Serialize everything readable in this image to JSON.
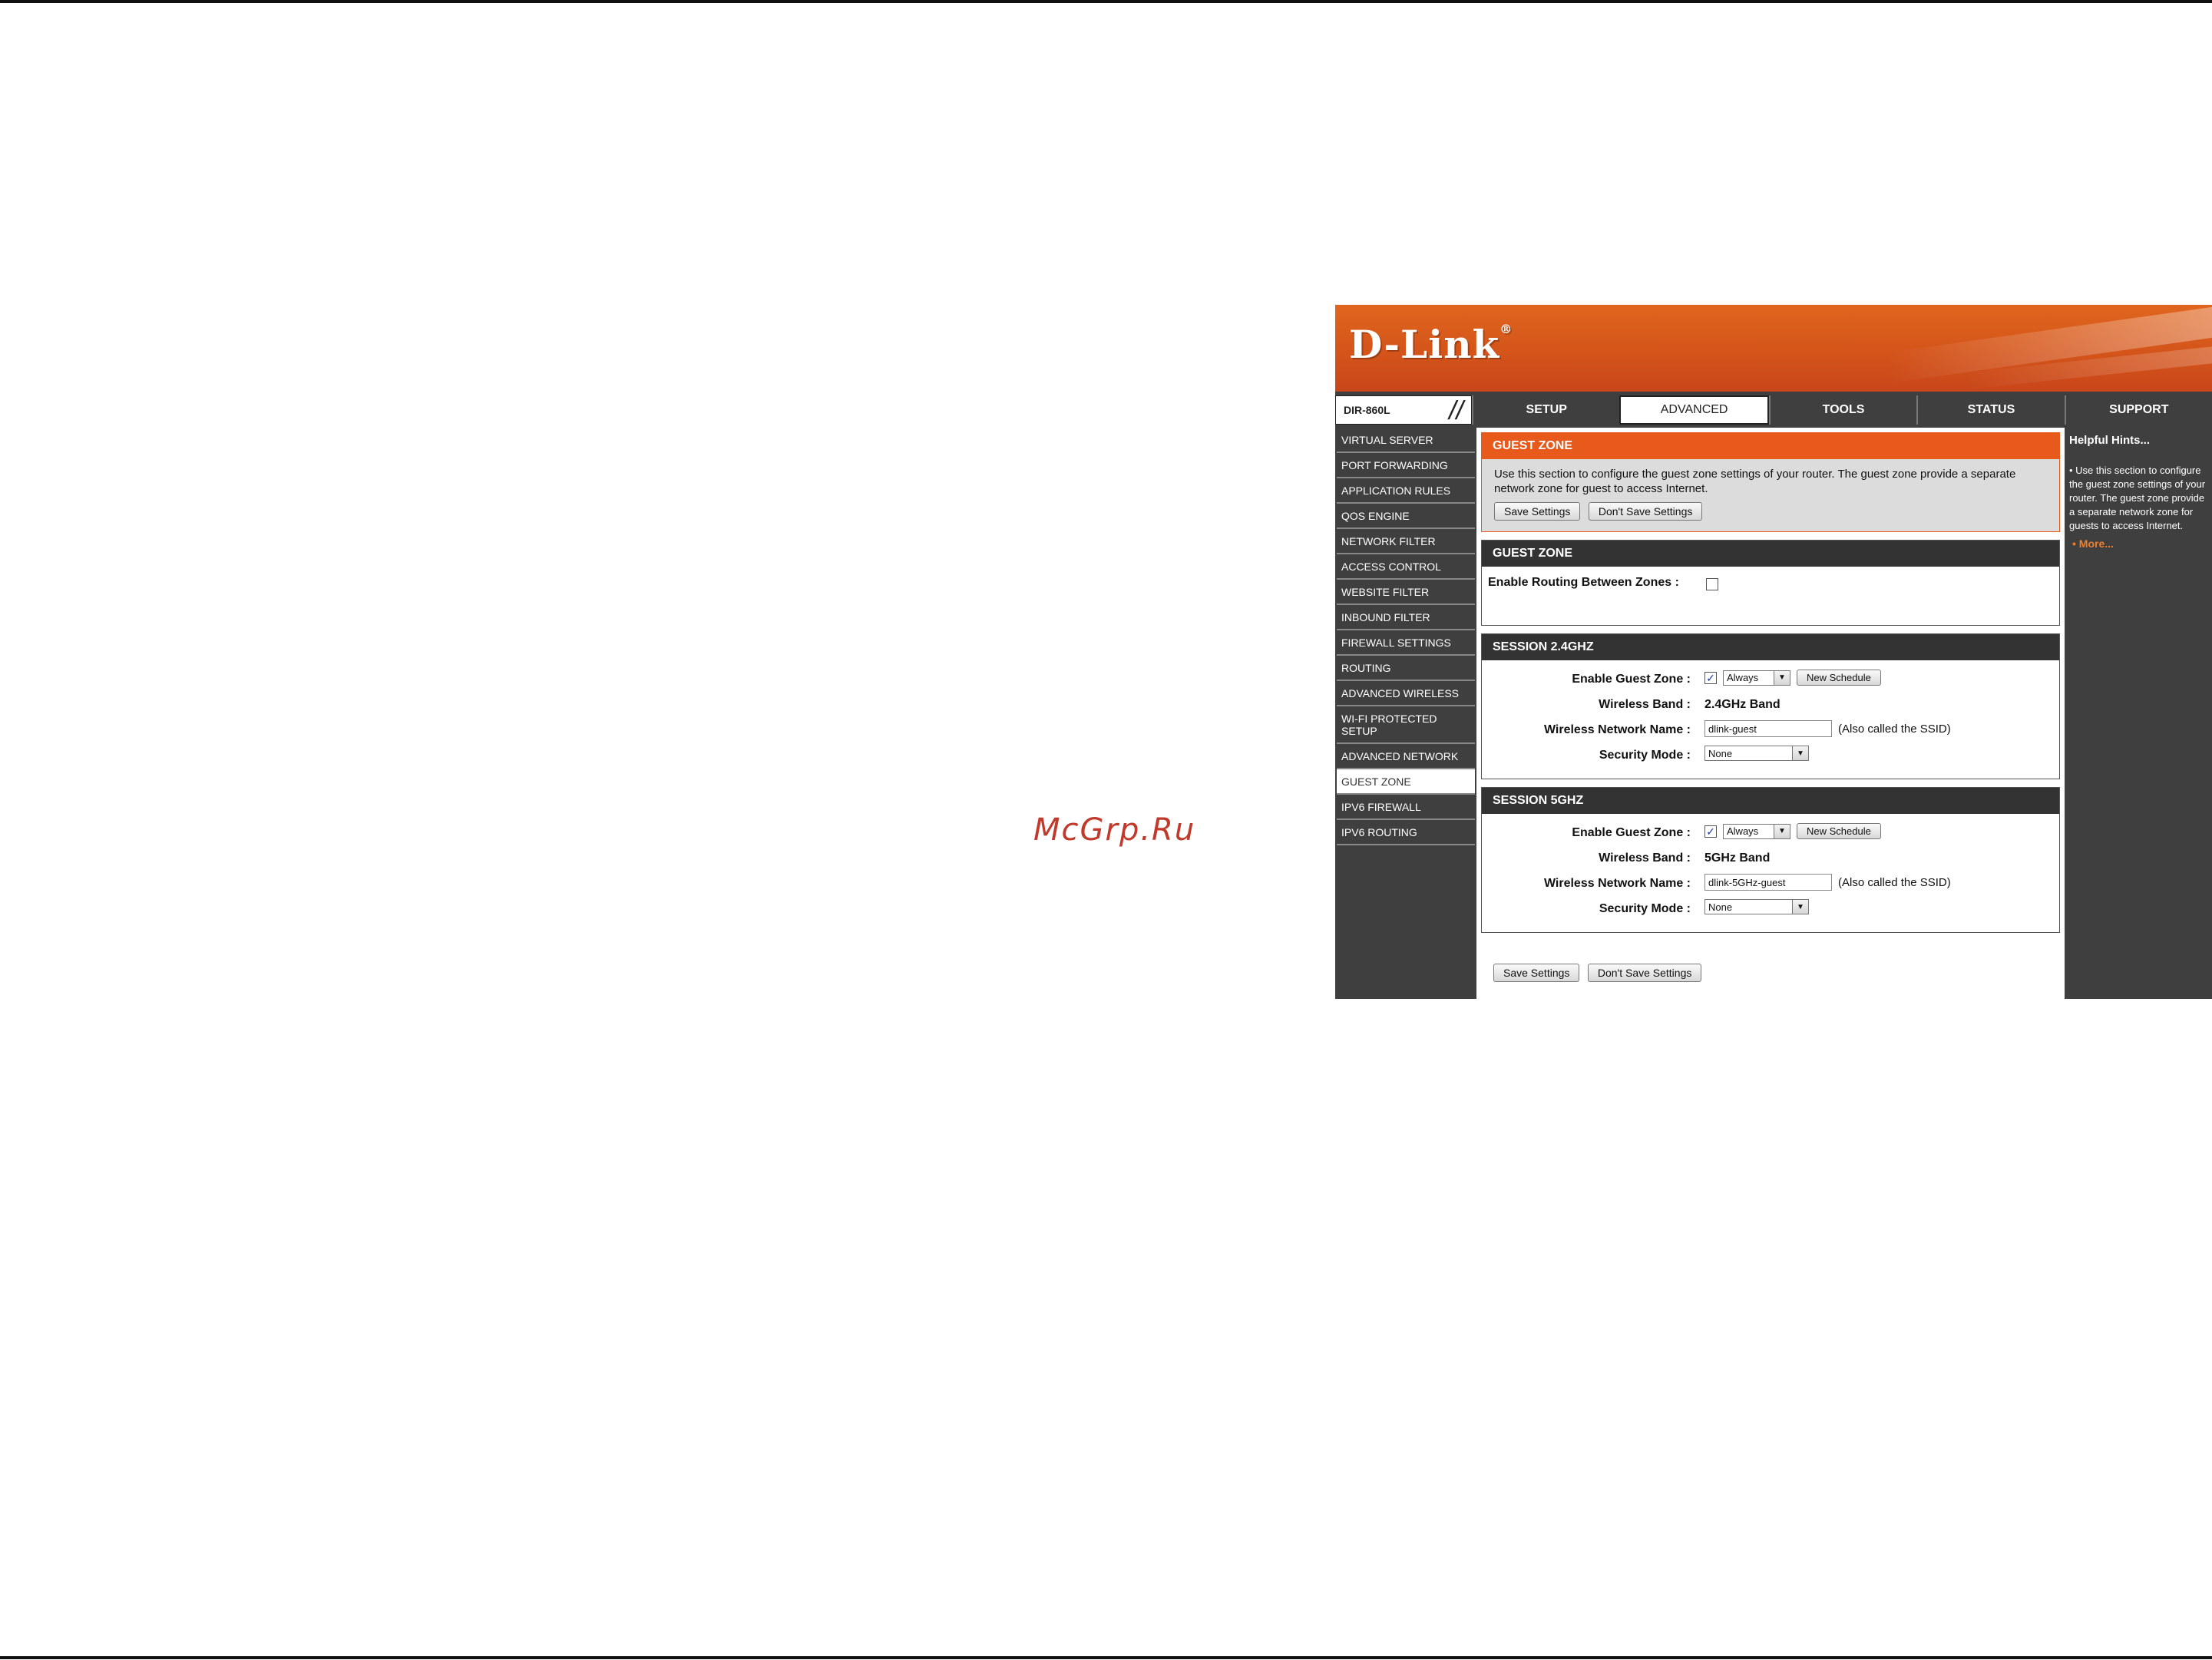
{
  "watermark": "McGrp.Ru",
  "header": {
    "logo_text": "D-Link",
    "logo_mark": "®"
  },
  "nav": {
    "model": "DIR-860L",
    "tabs": [
      {
        "label": "SETUP"
      },
      {
        "label": "ADVANCED"
      },
      {
        "label": "TOOLS"
      },
      {
        "label": "STATUS"
      },
      {
        "label": "SUPPORT"
      }
    ]
  },
  "sidebar": {
    "items": [
      {
        "label": "VIRTUAL SERVER"
      },
      {
        "label": "PORT FORWARDING"
      },
      {
        "label": "APPLICATION RULES"
      },
      {
        "label": "QOS ENGINE"
      },
      {
        "label": "NETWORK FILTER"
      },
      {
        "label": "ACCESS CONTROL"
      },
      {
        "label": "WEBSITE FILTER"
      },
      {
        "label": "INBOUND FILTER"
      },
      {
        "label": "FIREWALL SETTINGS"
      },
      {
        "label": "ROUTING"
      },
      {
        "label": "ADVANCED WIRELESS"
      },
      {
        "label": "WI-FI PROTECTED SETUP"
      },
      {
        "label": "ADVANCED NETWORK"
      },
      {
        "label": "GUEST ZONE"
      },
      {
        "label": "IPV6 FIREWALL"
      },
      {
        "label": "IPV6 ROUTING"
      }
    ]
  },
  "intro": {
    "title": "GUEST ZONE",
    "text": "Use this section to configure the guest zone settings of your router. The guest zone provide a separate network zone for guest to access Internet.",
    "save_label": "Save Settings",
    "dont_save_label": "Don't Save Settings"
  },
  "guest_zone": {
    "title": "GUEST ZONE",
    "routing_label": "Enable Routing Between Zones :",
    "routing_checked": false
  },
  "session24": {
    "title": "SESSION 2.4GHZ",
    "enable_label": "Enable Guest Zone :",
    "enable_checked": true,
    "schedule_value": "Always",
    "new_schedule_label": "New Schedule",
    "band_label": "Wireless Band :",
    "band_value": "2.4GHz Band",
    "ssid_label": "Wireless Network Name :",
    "ssid_value": "dlink-guest",
    "ssid_note": "(Also called the SSID)",
    "security_label": "Security Mode :",
    "security_value": "None"
  },
  "session5": {
    "title": "SESSION 5GHZ",
    "enable_label": "Enable Guest Zone :",
    "enable_checked": true,
    "schedule_value": "Always",
    "new_schedule_label": "New Schedule",
    "band_label": "Wireless Band :",
    "band_value": "5GHz Band",
    "ssid_label": "Wireless Network Name :",
    "ssid_value": "dlink-5GHz-guest",
    "ssid_note": "(Also called the SSID)",
    "security_label": "Security Mode :",
    "security_value": "None"
  },
  "footer_buttons": {
    "save_label": "Save Settings",
    "dont_save_label": "Don't Save Settings"
  },
  "hints": {
    "title": "Helpful Hints...",
    "text": "Use this section to configure the guest zone settings of your router. The guest zone provide a separate network zone for guests to access Internet.",
    "more_label": "More..."
  },
  "colors": {
    "accent": "#e85a1c",
    "dark": "#3f3f3f",
    "link": "#f07f2c"
  }
}
